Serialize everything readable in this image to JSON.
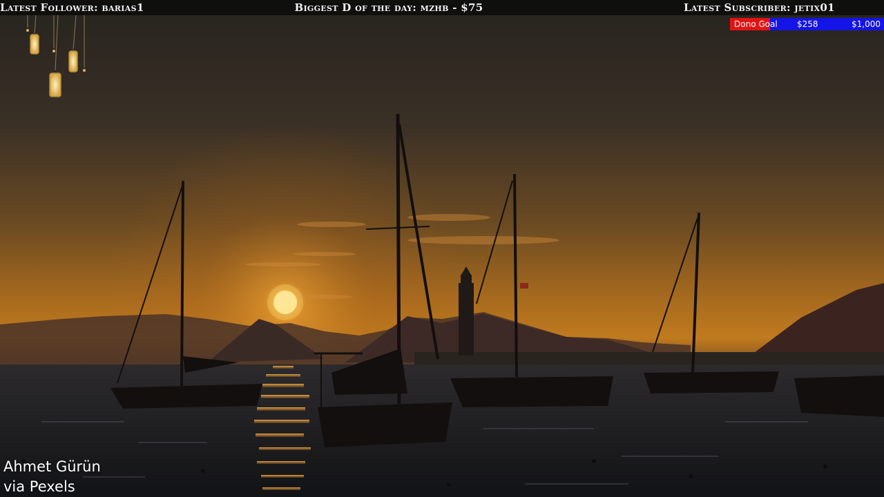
{
  "stream_bar": {
    "latest_follower": "Latest Follower: barias1",
    "biggest_donation": "Biggest D of the day: mzhb - $75",
    "latest_subscriber": "Latest Subscriber: jetix01"
  },
  "donation_goal": {
    "label": "Dono Goal",
    "current": "$258",
    "target": "$1,000",
    "progress_fraction": 0.258,
    "fill_color": "#e21313",
    "track_color": "#1414e6"
  },
  "credit": {
    "line1": "Ahmet Gürün",
    "line2": "via Pexels"
  },
  "scene": {
    "description_icon": "sunset-harbor-sailboats",
    "decor_icon": "hanging-lanterns-icon"
  }
}
